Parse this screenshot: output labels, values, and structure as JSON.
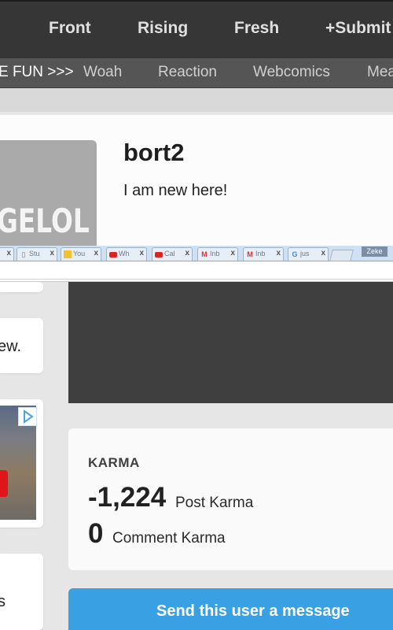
{
  "topnav": {
    "items": [
      "Front",
      "Rising",
      "Fresh",
      "+Submit"
    ]
  },
  "subnav": {
    "lead": "E FUN >>>",
    "items": [
      "Woah",
      "Reaction",
      "Webcomics",
      "Mea"
    ]
  },
  "profile": {
    "avatar_text": "GELOL",
    "username": "bort2",
    "bio": "I am new here!"
  },
  "browser": {
    "tabs": [
      {
        "title": "",
        "icon": "page-icon"
      },
      {
        "title": "Stu",
        "icon": "page-icon"
      },
      {
        "title": "You",
        "icon": "bookmark-icon"
      },
      {
        "title": "Wh",
        "icon": "youtube-icon"
      },
      {
        "title": "Cal",
        "icon": "youtube-icon"
      },
      {
        "title": "Inb",
        "icon": "gmail-icon"
      },
      {
        "title": "Inb",
        "icon": "gmail-icon"
      },
      {
        "title": "jus",
        "icon": "google-icon"
      }
    ],
    "profile_label": "Zeke"
  },
  "left_snippets": {
    "ew": "ew.",
    "s": "s"
  },
  "karma": {
    "title": "KARMA",
    "post_value": "-1,224",
    "post_label": "Post Karma",
    "comment_value": "0",
    "comment_label": "Comment Karma"
  },
  "actions": {
    "send_message": "Send this user a message"
  },
  "colors": {
    "nav_bg": "#363636",
    "subnav_bg": "#555555",
    "accent_button": "#39a0e4"
  }
}
